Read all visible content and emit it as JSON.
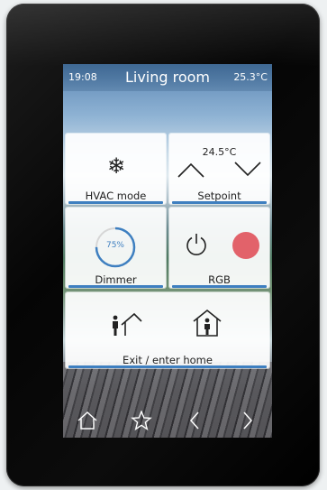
{
  "status": {
    "time": "19:08",
    "room": "Living room",
    "temperature": "25.3°C"
  },
  "tiles": {
    "hvac": {
      "label": "HVAC mode",
      "icon": "snowflake-icon"
    },
    "setpoint": {
      "label": "Setpoint",
      "value": "24.5°C"
    },
    "dimmer": {
      "label": "Dimmer",
      "level": "75%"
    },
    "rgb": {
      "label": "RGB",
      "color": "#e2626a"
    },
    "home": {
      "label": "Exit / enter home"
    }
  },
  "nav": [
    "home-icon",
    "star-icon",
    "chevron-left-icon",
    "chevron-right-icon"
  ],
  "colors": {
    "accent": "#3e7fc0"
  }
}
